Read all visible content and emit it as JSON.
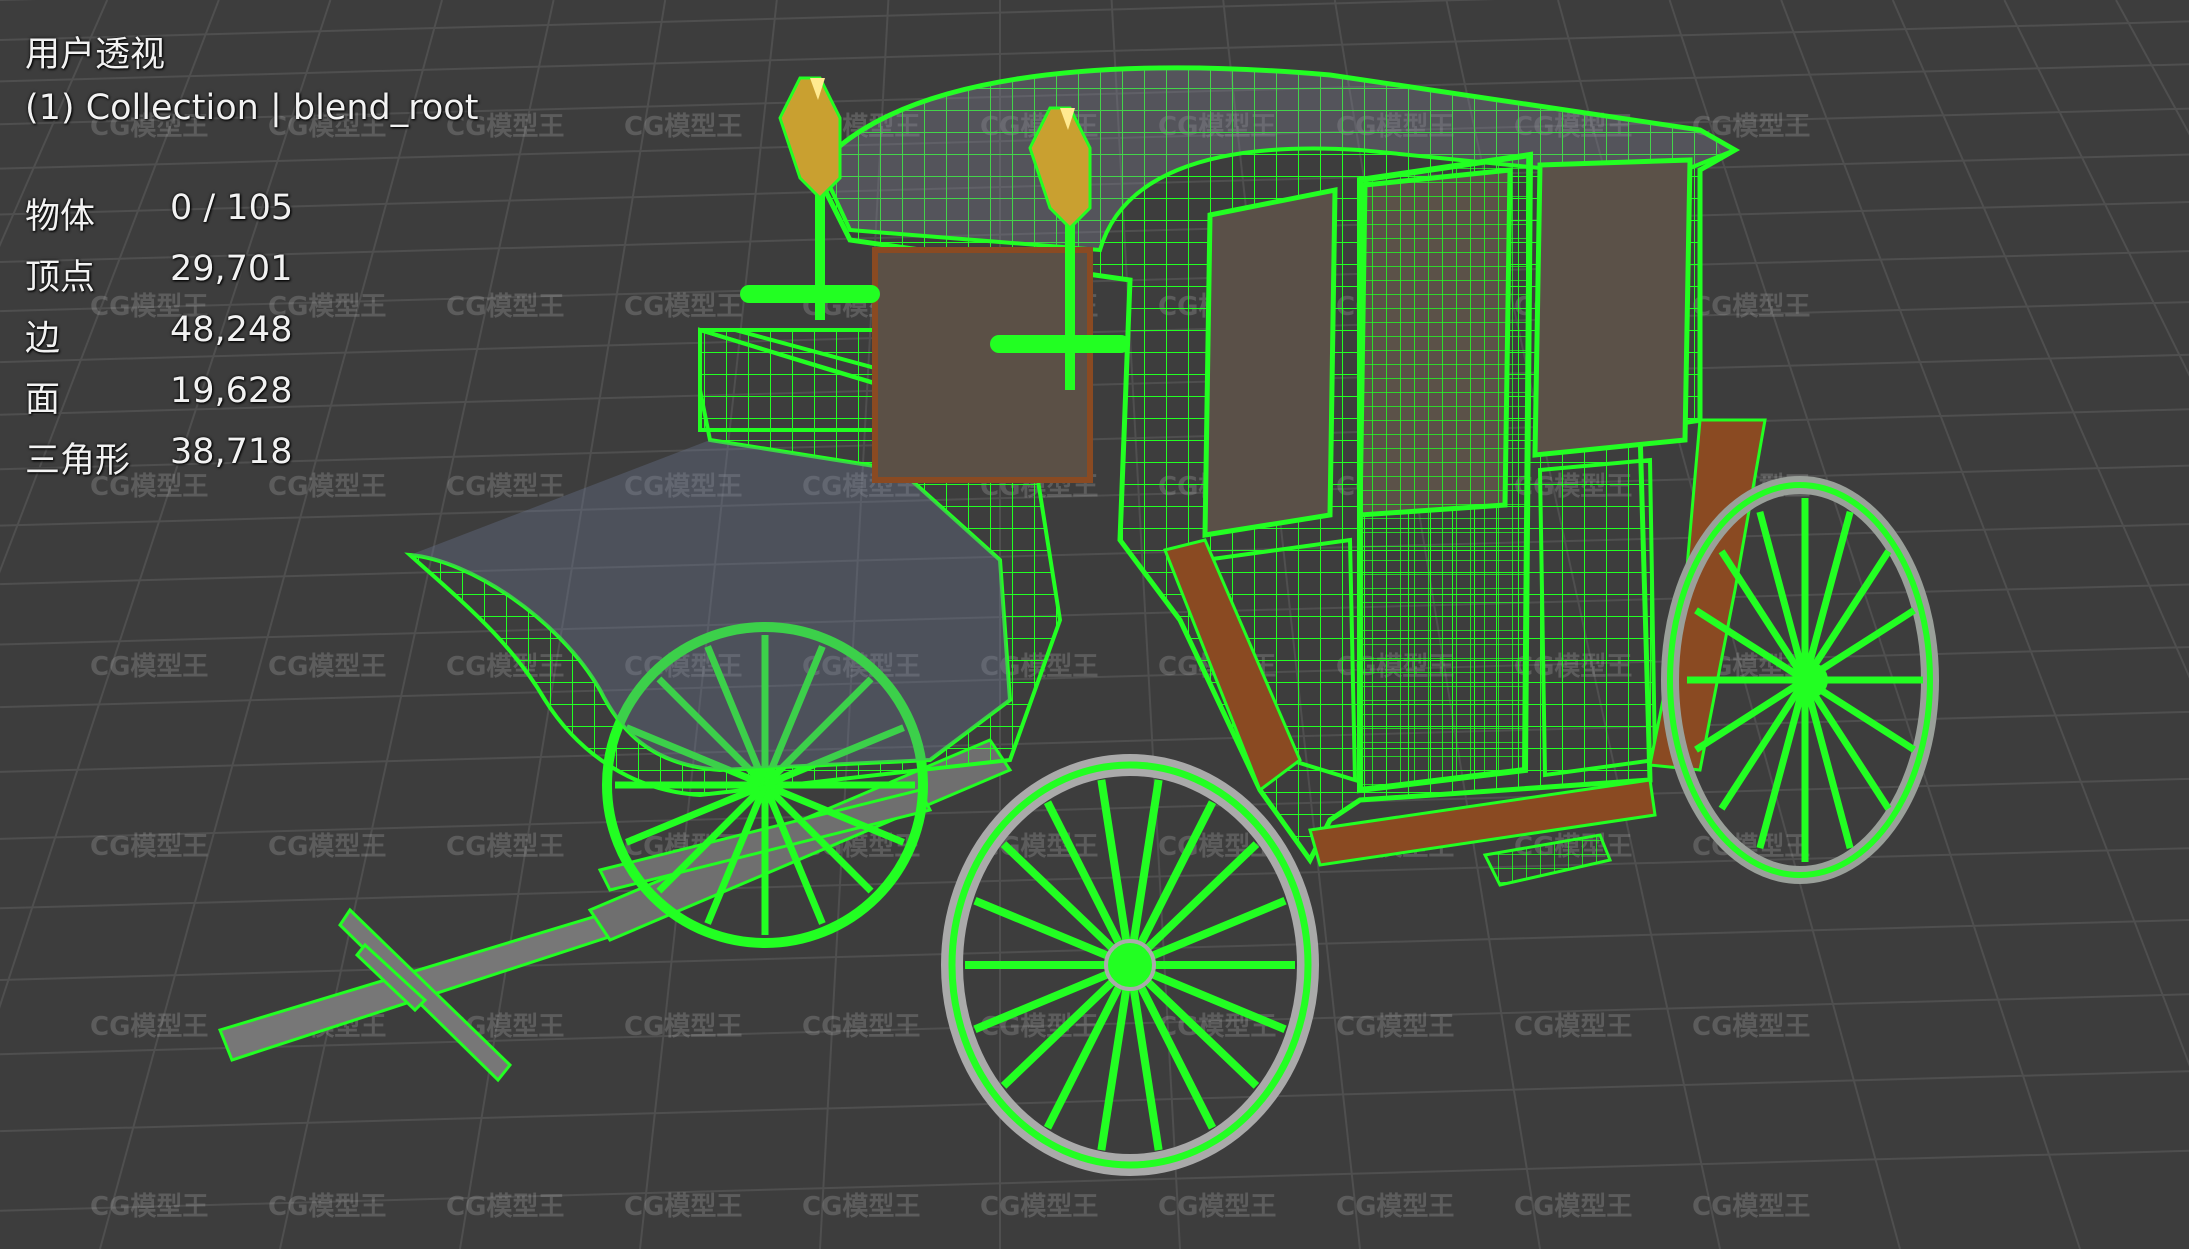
{
  "viewport": {
    "view_mode": "用户透视",
    "collection_label": "(1) Collection | blend_root",
    "stats": [
      {
        "label": "物体",
        "value": "0 / 105"
      },
      {
        "label": "顶点",
        "value": "29,701"
      },
      {
        "label": "边",
        "value": "48,248"
      },
      {
        "label": "面",
        "value": "19,628"
      },
      {
        "label": "三角形",
        "value": "38,718"
      }
    ],
    "watermark": "CG模型王"
  },
  "colors": {
    "background": "#3d3d3d",
    "grid": "#4d4d4d",
    "wireframe": "#22ff22",
    "wood": "#8a4a22",
    "glass": "#5b5046",
    "metal": "#8c8c8c",
    "lamp_gold": "#c9a030"
  }
}
